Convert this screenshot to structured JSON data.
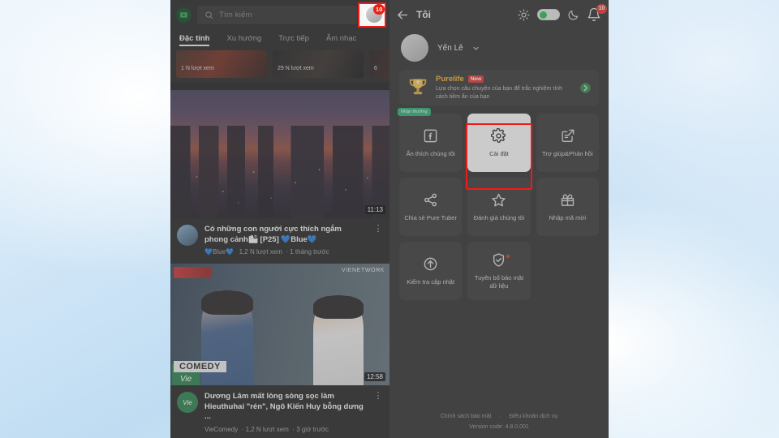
{
  "left_app": {
    "logo_icon": "pure-tuber-play-logo",
    "search": {
      "icon": "search-icon",
      "placeholder": "Tìm kiếm",
      "value": ""
    },
    "avatar": {
      "icon": "avatar",
      "badge": "10"
    },
    "tabs": [
      {
        "label": "Đặc tính",
        "active": true
      },
      {
        "label": "Xu hướng",
        "active": false
      },
      {
        "label": "Trực tiếp",
        "active": false
      },
      {
        "label": "Âm nhạc",
        "active": false
      }
    ],
    "shelf": [
      {
        "views": "1 N lượt xem"
      },
      {
        "views": "29 N lượt xem"
      },
      {
        "views": "6"
      }
    ],
    "videos": [
      {
        "title": "Có những con người cực thích ngắm phong cảnh🏙 [P25] 💙Blue💙",
        "channel": "💙Blue💙",
        "views": "1,2 N lượt xem",
        "age": "1 tháng trước",
        "duration": "11:13",
        "menu_icon": "kebab-menu-icon"
      },
      {
        "title": "Dương Lâm mất lòng sòng sọc làm Hieuthuhai \"rén\", Ngô Kiến Huy bỗng dưng ...",
        "channel": "VieComedy",
        "views": "1,2 N lượt xem",
        "age": "3 giờ trước",
        "duration": "12:58",
        "thumb_tag": "COMEDY",
        "thumb_brand": "Vie",
        "thumb_network": "VIENETWORK",
        "menu_icon": "kebab-menu-icon"
      }
    ]
  },
  "right_app": {
    "header": {
      "back_icon": "back-arrow-icon",
      "title": "Tôi",
      "sun_icon": "sun-icon",
      "theme_toggle": "theme-toggle",
      "moon_icon": "moon-icon",
      "bell_icon": "bell-icon",
      "bell_badge": "10"
    },
    "profile": {
      "avatar_icon": "profile-avatar",
      "name": "Yến Lê",
      "chevron_icon": "chevron-down-icon"
    },
    "banner": {
      "trophy_icon": "trophy-icon",
      "title": "Purelife",
      "badge": "New",
      "description": "Lựa chọn câu chuyện của bạn để trắc nghiệm tính cách tiềm ẩn của bạn",
      "go_icon": "chevron-right-circle-icon"
    },
    "tiles": [
      {
        "icon": "facebook-icon",
        "label": "Ấn thích chúng tôi",
        "hot_badge": "Nhận thưởng",
        "highlighted": false
      },
      {
        "icon": "gear-icon",
        "label": "Cài đặt",
        "highlighted": true
      },
      {
        "icon": "feedback-icon",
        "label": "Trợ giúp&Phản hồi",
        "highlighted": false
      },
      {
        "icon": "share-icon",
        "label": "Chia sẻ Pure Tuber",
        "highlighted": false
      },
      {
        "icon": "star-icon",
        "label": "Đánh giá chúng tôi",
        "highlighted": false
      },
      {
        "icon": "gift-icon",
        "label": "Nhập mã mời",
        "highlighted": false
      },
      {
        "icon": "update-arrow-icon",
        "label": "Kiểm tra cập nhật",
        "highlighted": false
      },
      {
        "icon": "shield-check-icon",
        "label": "Tuyên bố bảo mật dữ liệu",
        "highlighted": false,
        "dot": true
      }
    ],
    "footer": {
      "privacy": "Chính sách bảo mật",
      "separator": "·",
      "terms": "Điều khoản dịch vụ",
      "version": "Version code: 4.8.0.001"
    }
  },
  "colors": {
    "highlight": "#ee1b1b",
    "badge_red": "#e62117",
    "accent_green": "#14b84b",
    "banner_gold": "#f2b01e",
    "background": "#cde4f6"
  }
}
